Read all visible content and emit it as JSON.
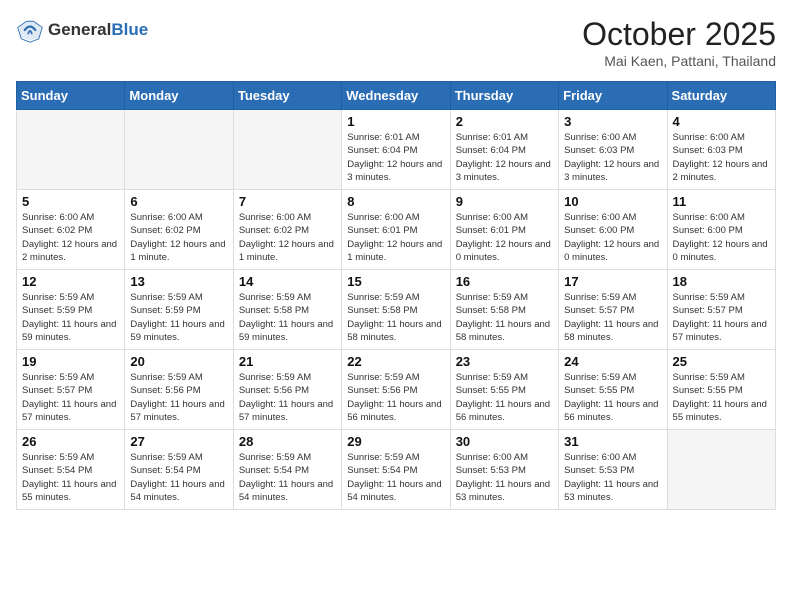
{
  "header": {
    "logo_general": "General",
    "logo_blue": "Blue",
    "month_title": "October 2025",
    "location": "Mai Kaen, Pattani, Thailand"
  },
  "days_of_week": [
    "Sunday",
    "Monday",
    "Tuesday",
    "Wednesday",
    "Thursday",
    "Friday",
    "Saturday"
  ],
  "weeks": [
    [
      {
        "day": "",
        "empty": true
      },
      {
        "day": "",
        "empty": true
      },
      {
        "day": "",
        "empty": true
      },
      {
        "day": "1",
        "sunrise": "6:01 AM",
        "sunset": "6:04 PM",
        "daylight": "12 hours and 3 minutes."
      },
      {
        "day": "2",
        "sunrise": "6:01 AM",
        "sunset": "6:04 PM",
        "daylight": "12 hours and 3 minutes."
      },
      {
        "day": "3",
        "sunrise": "6:00 AM",
        "sunset": "6:03 PM",
        "daylight": "12 hours and 3 minutes."
      },
      {
        "day": "4",
        "sunrise": "6:00 AM",
        "sunset": "6:03 PM",
        "daylight": "12 hours and 2 minutes."
      }
    ],
    [
      {
        "day": "5",
        "sunrise": "6:00 AM",
        "sunset": "6:02 PM",
        "daylight": "12 hours and 2 minutes."
      },
      {
        "day": "6",
        "sunrise": "6:00 AM",
        "sunset": "6:02 PM",
        "daylight": "12 hours and 1 minute."
      },
      {
        "day": "7",
        "sunrise": "6:00 AM",
        "sunset": "6:02 PM",
        "daylight": "12 hours and 1 minute."
      },
      {
        "day": "8",
        "sunrise": "6:00 AM",
        "sunset": "6:01 PM",
        "daylight": "12 hours and 1 minute."
      },
      {
        "day": "9",
        "sunrise": "6:00 AM",
        "sunset": "6:01 PM",
        "daylight": "12 hours and 0 minutes."
      },
      {
        "day": "10",
        "sunrise": "6:00 AM",
        "sunset": "6:00 PM",
        "daylight": "12 hours and 0 minutes."
      },
      {
        "day": "11",
        "sunrise": "6:00 AM",
        "sunset": "6:00 PM",
        "daylight": "12 hours and 0 minutes."
      }
    ],
    [
      {
        "day": "12",
        "sunrise": "5:59 AM",
        "sunset": "5:59 PM",
        "daylight": "11 hours and 59 minutes."
      },
      {
        "day": "13",
        "sunrise": "5:59 AM",
        "sunset": "5:59 PM",
        "daylight": "11 hours and 59 minutes."
      },
      {
        "day": "14",
        "sunrise": "5:59 AM",
        "sunset": "5:58 PM",
        "daylight": "11 hours and 59 minutes."
      },
      {
        "day": "15",
        "sunrise": "5:59 AM",
        "sunset": "5:58 PM",
        "daylight": "11 hours and 58 minutes."
      },
      {
        "day": "16",
        "sunrise": "5:59 AM",
        "sunset": "5:58 PM",
        "daylight": "11 hours and 58 minutes."
      },
      {
        "day": "17",
        "sunrise": "5:59 AM",
        "sunset": "5:57 PM",
        "daylight": "11 hours and 58 minutes."
      },
      {
        "day": "18",
        "sunrise": "5:59 AM",
        "sunset": "5:57 PM",
        "daylight": "11 hours and 57 minutes."
      }
    ],
    [
      {
        "day": "19",
        "sunrise": "5:59 AM",
        "sunset": "5:57 PM",
        "daylight": "11 hours and 57 minutes."
      },
      {
        "day": "20",
        "sunrise": "5:59 AM",
        "sunset": "5:56 PM",
        "daylight": "11 hours and 57 minutes."
      },
      {
        "day": "21",
        "sunrise": "5:59 AM",
        "sunset": "5:56 PM",
        "daylight": "11 hours and 57 minutes."
      },
      {
        "day": "22",
        "sunrise": "5:59 AM",
        "sunset": "5:56 PM",
        "daylight": "11 hours and 56 minutes."
      },
      {
        "day": "23",
        "sunrise": "5:59 AM",
        "sunset": "5:55 PM",
        "daylight": "11 hours and 56 minutes."
      },
      {
        "day": "24",
        "sunrise": "5:59 AM",
        "sunset": "5:55 PM",
        "daylight": "11 hours and 56 minutes."
      },
      {
        "day": "25",
        "sunrise": "5:59 AM",
        "sunset": "5:55 PM",
        "daylight": "11 hours and 55 minutes."
      }
    ],
    [
      {
        "day": "26",
        "sunrise": "5:59 AM",
        "sunset": "5:54 PM",
        "daylight": "11 hours and 55 minutes."
      },
      {
        "day": "27",
        "sunrise": "5:59 AM",
        "sunset": "5:54 PM",
        "daylight": "11 hours and 54 minutes."
      },
      {
        "day": "28",
        "sunrise": "5:59 AM",
        "sunset": "5:54 PM",
        "daylight": "11 hours and 54 minutes."
      },
      {
        "day": "29",
        "sunrise": "5:59 AM",
        "sunset": "5:54 PM",
        "daylight": "11 hours and 54 minutes."
      },
      {
        "day": "30",
        "sunrise": "6:00 AM",
        "sunset": "5:53 PM",
        "daylight": "11 hours and 53 minutes."
      },
      {
        "day": "31",
        "sunrise": "6:00 AM",
        "sunset": "5:53 PM",
        "daylight": "11 hours and 53 minutes."
      },
      {
        "day": "",
        "empty": true
      }
    ]
  ]
}
